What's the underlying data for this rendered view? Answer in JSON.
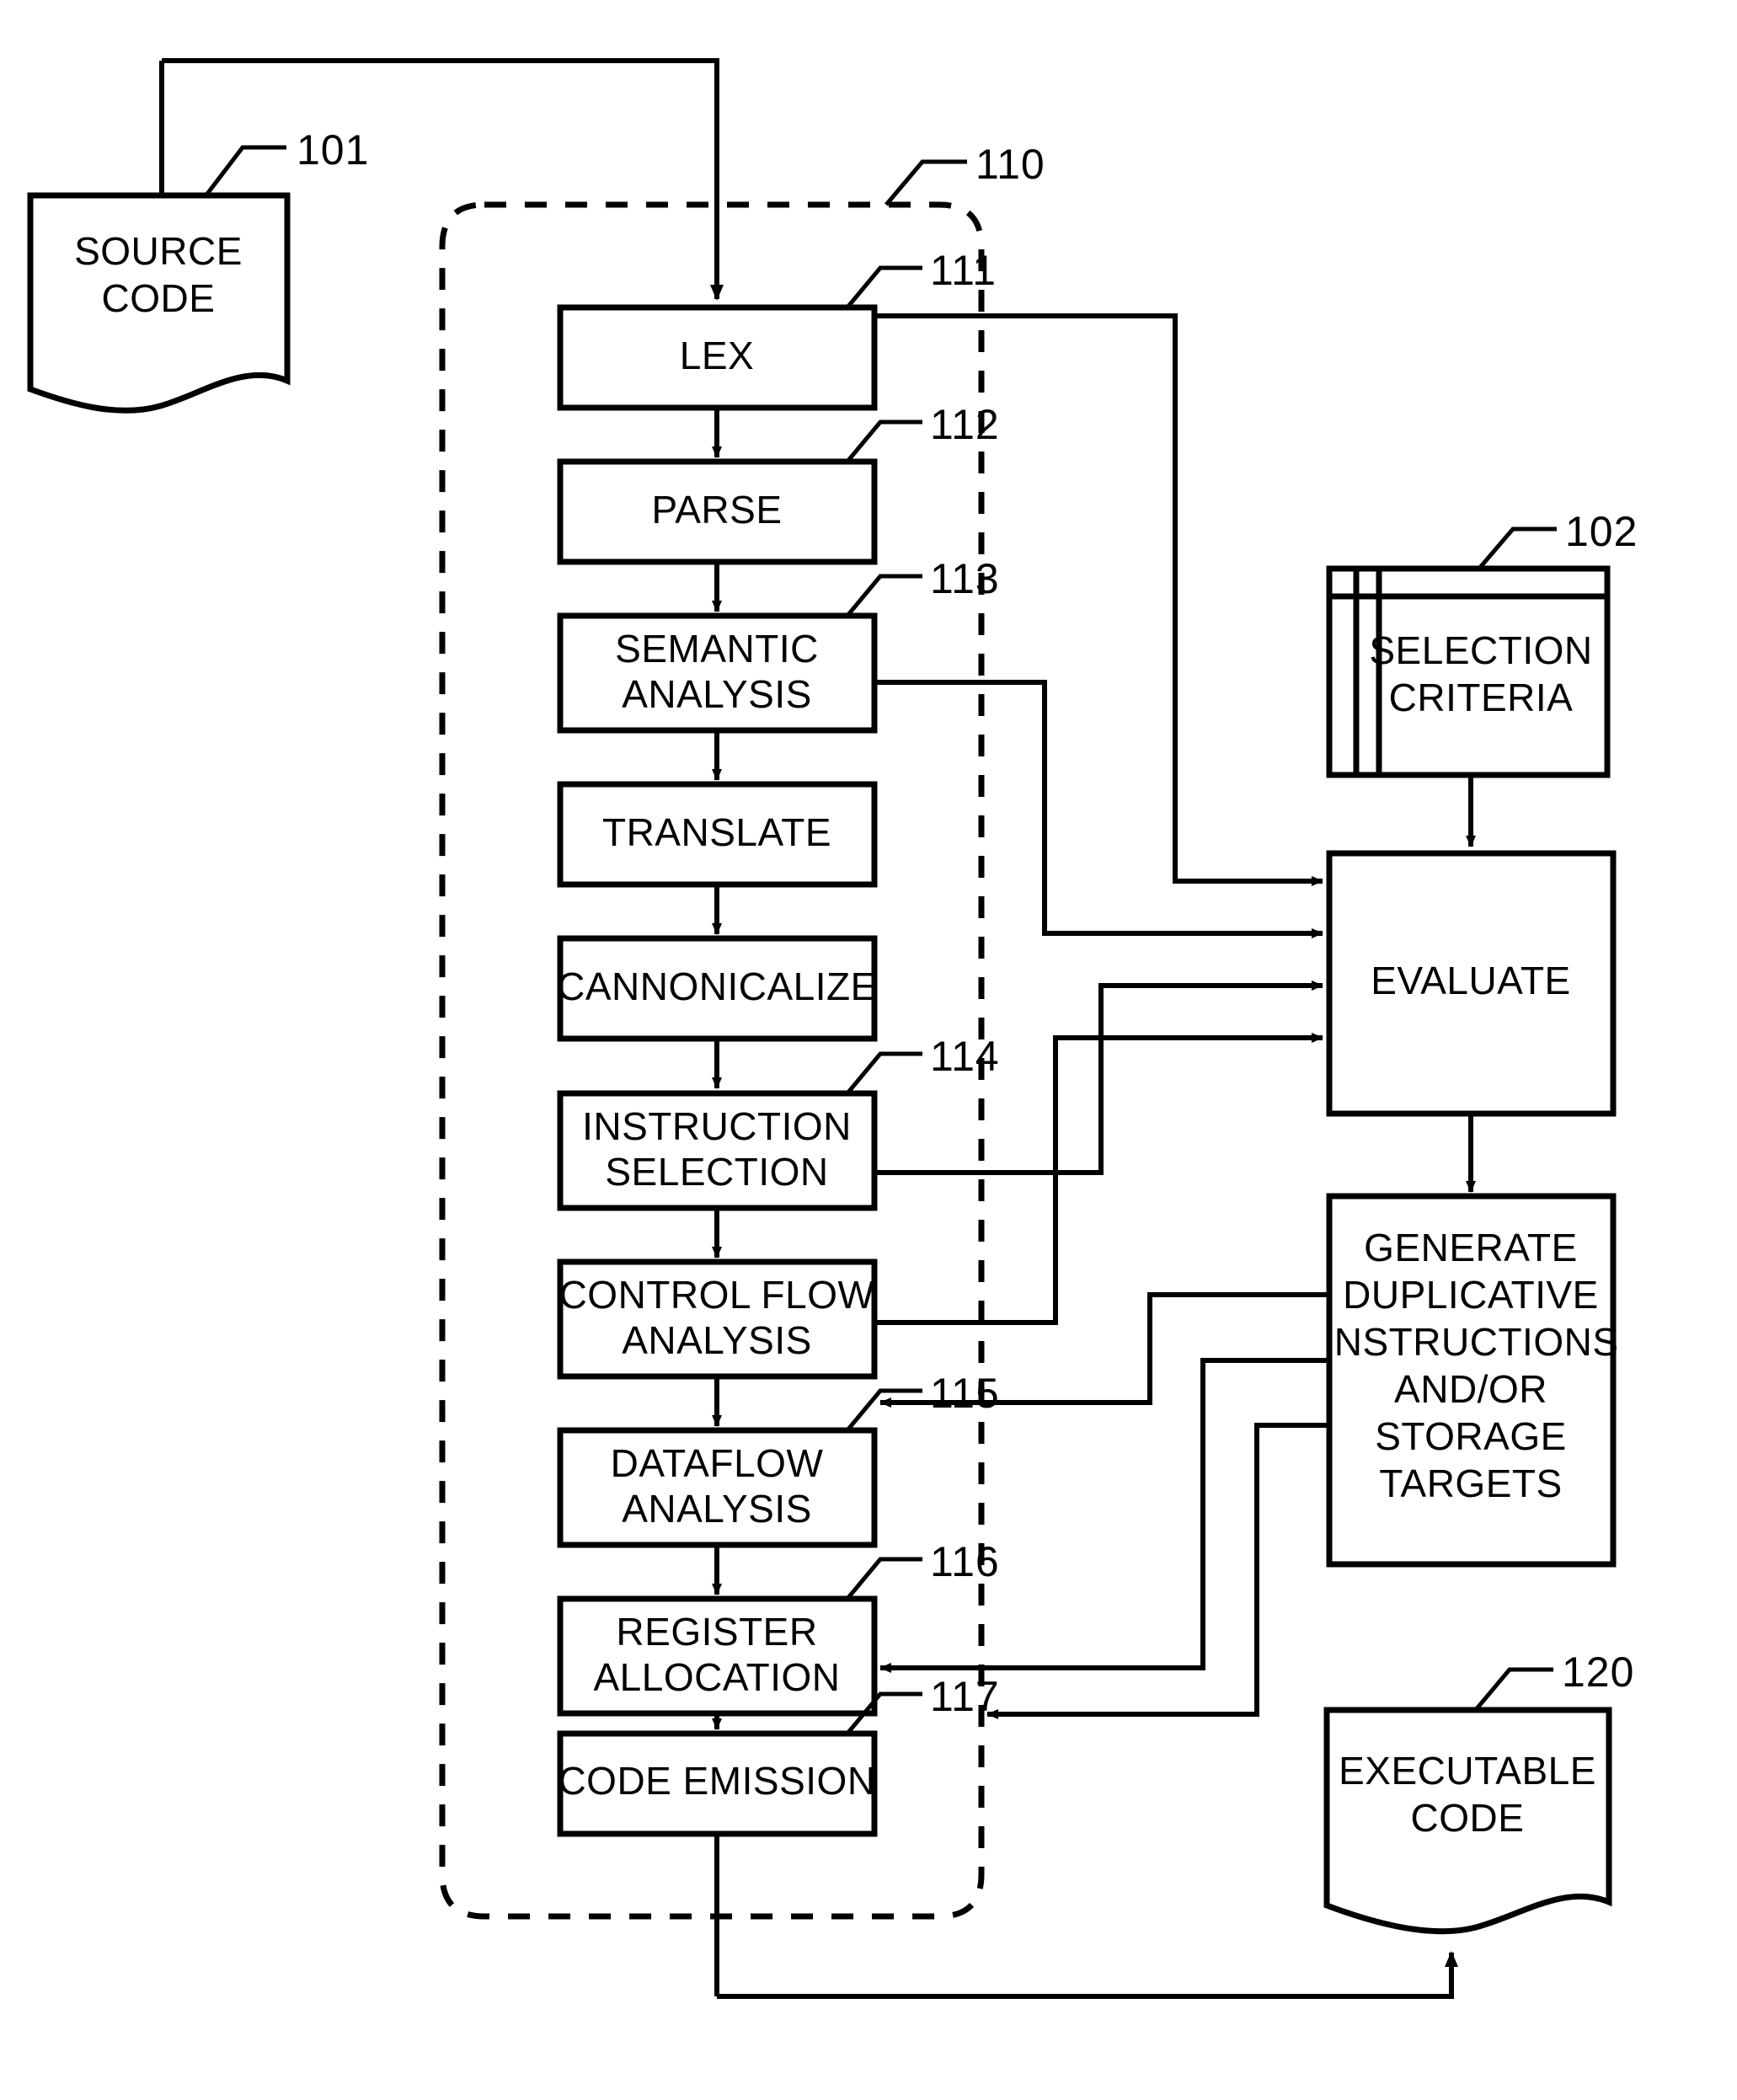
{
  "figure": {
    "kind": "patent-flowchart",
    "title": "Compiler pipeline with duplicative instruction generation",
    "stroke_color": "#000000",
    "background_color": "#ffffff"
  },
  "documents": {
    "source_code": {
      "ref": "101",
      "lines": [
        "SOURCE",
        "CODE"
      ]
    },
    "executable_code": {
      "ref": "120",
      "lines": [
        "EXECUTABLE",
        "CODE"
      ]
    }
  },
  "compiler_group": {
    "ref": "110",
    "style": "dashed-rounded-rectangle"
  },
  "stages": [
    {
      "ref": "111",
      "lines": [
        "LEX"
      ]
    },
    {
      "ref": "112",
      "lines": [
        "PARSE"
      ]
    },
    {
      "ref": "113",
      "lines": [
        "SEMANTIC",
        "ANALYSIS"
      ]
    },
    {
      "ref": "",
      "lines": [
        "TRANSLATE"
      ]
    },
    {
      "ref": "",
      "lines": [
        "CANNONICALIZE"
      ]
    },
    {
      "ref": "114",
      "lines": [
        "INSTRUCTION",
        "SELECTION"
      ]
    },
    {
      "ref": "",
      "lines": [
        "CONTROL FLOW",
        "ANALYSIS"
      ]
    },
    {
      "ref": "115",
      "lines": [
        "DATAFLOW",
        "ANALYSIS"
      ]
    },
    {
      "ref": "116",
      "lines": [
        "REGISTER",
        "ALLOCATION"
      ]
    },
    {
      "ref": "117",
      "lines": [
        "CODE EMISSION"
      ]
    }
  ],
  "side_blocks": {
    "selection_criteria": {
      "ref": "102",
      "lines": [
        "SELECTION",
        "CRITERIA"
      ],
      "style": "stored-data-card"
    },
    "evaluate": {
      "ref": "",
      "lines": [
        "EVALUATE"
      ]
    },
    "generate": {
      "ref": "",
      "lines": [
        "GENERATE",
        "DUPLICATIVE",
        "INSTRUCTIONS",
        "AND/OR",
        "STORAGE",
        "TARGETS"
      ]
    }
  },
  "stage_text": {
    "lex": "LEX",
    "parse": "PARSE",
    "semantic_1": "SEMANTIC",
    "semantic_2": "ANALYSIS",
    "translate": "TRANSLATE",
    "cannonicalize": "CANNONICALIZE",
    "instrsel_1": "INSTRUCTION",
    "instrsel_2": "SELECTION",
    "ctrlflow_1": "CONTROL FLOW",
    "ctrlflow_2": "ANALYSIS",
    "dataflow_1": "DATAFLOW",
    "dataflow_2": "ANALYSIS",
    "regalloc_1": "REGISTER",
    "regalloc_2": "ALLOCATION",
    "codeemit": "CODE EMISSION",
    "source_1": "SOURCE",
    "source_2": "CODE",
    "seccrit_1": "SELECTION",
    "seccrit_2": "CRITERIA",
    "evaluate": "EVALUATE",
    "gen_1": "GENERATE",
    "gen_2": "DUPLICATIVE",
    "gen_3": "INSTRUCTIONS",
    "gen_4": "AND/OR",
    "gen_5": "STORAGE",
    "gen_6": "TARGETS",
    "exec_1": "EXECUTABLE",
    "exec_2": "CODE"
  },
  "refs": {
    "r101": "101",
    "r110": "110",
    "r111": "111",
    "r112": "112",
    "r113": "113",
    "r114": "114",
    "r115": "115",
    "r116": "116",
    "r117": "117",
    "r102": "102",
    "r120": "120"
  }
}
